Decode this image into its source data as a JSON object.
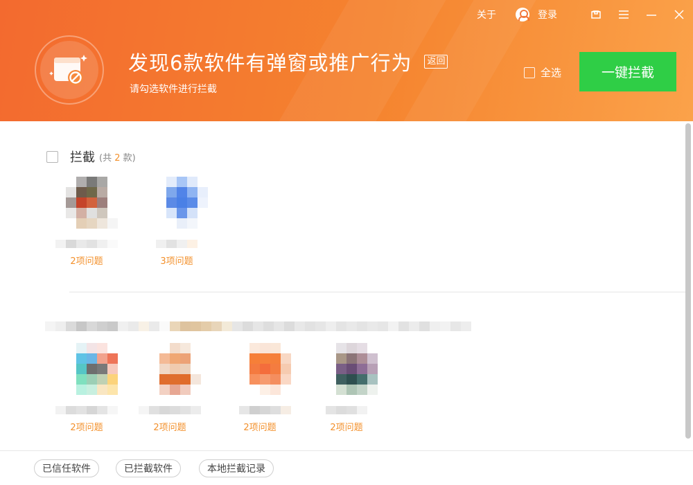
{
  "topbar": {
    "about_label": "关于",
    "login_label": "登录",
    "icons": [
      "user-icon",
      "skin-icon",
      "menu-icon",
      "minimize-icon",
      "close-icon"
    ]
  },
  "header": {
    "title": "发现6款软件有弹窗或推广行为",
    "back_label": "返回",
    "subtitle": "请勾选软件进行拦截",
    "select_all_label": "全选",
    "block_all_label": "一键拦截",
    "badge_icon": "popup-block-icon"
  },
  "groups": [
    {
      "title": "拦截",
      "count_prefix": "(共",
      "count": "2",
      "count_suffix": "款)",
      "apps": [
        {
          "issues": "2项问题"
        },
        {
          "issues": "3项问题"
        }
      ]
    },
    {
      "apps": [
        {
          "issues": "2项问题"
        },
        {
          "issues": "2项问题"
        },
        {
          "issues": "2项问题"
        },
        {
          "issues": "2项问题"
        }
      ]
    }
  ],
  "footer": {
    "trusted_label": "已信任软件",
    "blocked_label": "已拦截软件",
    "history_label": "本地拦截记录"
  },
  "colors": {
    "header_start": "#f36a2f",
    "header_end": "#fba24a",
    "accent_green": "#2fce46",
    "issue_orange": "#f3902b"
  }
}
